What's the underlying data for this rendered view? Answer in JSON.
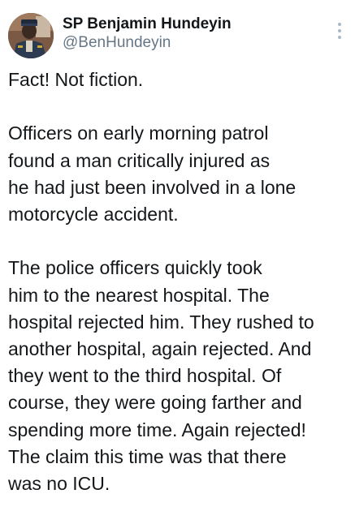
{
  "author": {
    "display_name": "SP Benjamin Hundeyin",
    "handle": "@BenHundeyin",
    "avatar_icon": "profile-photo"
  },
  "menu": {
    "icon": "more-vertical-icon"
  },
  "tweet": {
    "paragraphs": [
      {
        "lines": [
          "Fact! Not fiction."
        ]
      },
      {
        "lines": [
          "Officers on early morning patrol",
          "found a man critically injured as",
          "he had just been involved in a lone",
          "motorcycle accident."
        ]
      },
      {
        "lines": [
          "The police officers quickly took",
          "him to the nearest hospital. The",
          "hospital rejected him. They rushed to",
          "another hospital, again rejected. And",
          "they went to the third hospital. Of",
          "course, they were going farther and",
          "spending more time. Again rejected!",
          "The claim this time was that there",
          "was no ICU."
        ]
      }
    ]
  },
  "colors": {
    "text": "#14171a",
    "secondary_text": "#657786",
    "menu_dots": "#aab8c2",
    "background": "#ffffff"
  }
}
